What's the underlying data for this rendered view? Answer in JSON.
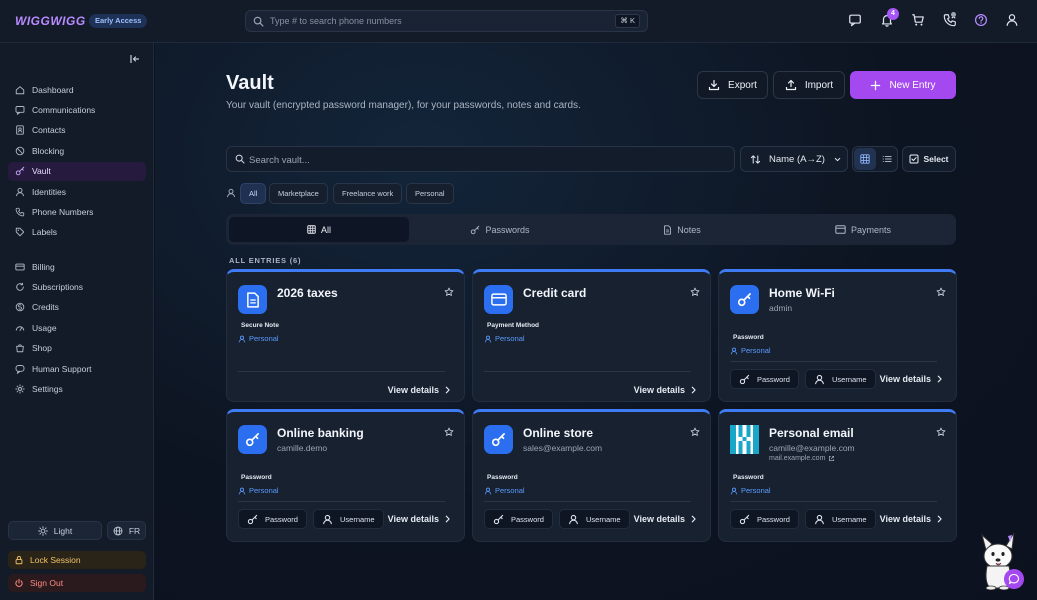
{
  "app": {
    "logo": "WIGGWIGG",
    "badge": "Early Access"
  },
  "topbar": {
    "search_placeholder": "Type # to search phone numbers",
    "shortcut": "⌘ K",
    "notification_count": "4"
  },
  "sidebar": {
    "groups": [
      [
        {
          "label": "Dashboard",
          "icon": "home-icon"
        },
        {
          "label": "Communications",
          "icon": "chat-icon"
        },
        {
          "label": "Contacts",
          "icon": "contacts-icon"
        },
        {
          "label": "Blocking",
          "icon": "block-icon"
        },
        {
          "label": "Vault",
          "icon": "key-icon",
          "active": true
        },
        {
          "label": "Identities",
          "icon": "person-icon"
        },
        {
          "label": "Phone Numbers",
          "icon": "phone-icon"
        },
        {
          "label": "Labels",
          "icon": "tag-icon"
        }
      ],
      [
        {
          "label": "Billing",
          "icon": "billing-icon"
        },
        {
          "label": "Subscriptions",
          "icon": "refresh-icon"
        },
        {
          "label": "Credits",
          "icon": "coin-icon"
        },
        {
          "label": "Usage",
          "icon": "gauge-icon"
        },
        {
          "label": "Shop",
          "icon": "shop-icon"
        },
        {
          "label": "Human Support",
          "icon": "support-icon"
        },
        {
          "label": "Settings",
          "icon": "gear-icon"
        }
      ]
    ],
    "theme_label": "Light",
    "language_label": "FR",
    "lock_label": "Lock Session",
    "signout_label": "Sign Out"
  },
  "page": {
    "title": "Vault",
    "subtitle": "Your vault (encrypted password manager), for your passwords, notes and cards.",
    "export_label": "Export",
    "import_label": "Import",
    "new_entry_label": "New Entry",
    "search_placeholder": "Search vault...",
    "sort_label": "Name (A→Z)",
    "select_label": "Select",
    "identity_filters": [
      "All",
      "Marketplace",
      "Freelance work",
      "Personal"
    ],
    "tabs": [
      "All",
      "Passwords",
      "Notes",
      "Payments"
    ],
    "entries_label": "ALL ENTRIES (6)"
  },
  "entries": [
    {
      "title": "2026 taxes",
      "subtitle": "",
      "type": "Secure Note",
      "folder": "Personal",
      "icon": "document-icon",
      "view": "View details"
    },
    {
      "title": "Credit card",
      "subtitle": "",
      "type": "Payment Method",
      "folder": "Personal",
      "icon": "credit-card-icon",
      "view": "View details"
    },
    {
      "title": "Home Wi-Fi",
      "subtitle": "admin",
      "type": "Password",
      "folder": "Personal",
      "icon": "key-icon",
      "view": "View details",
      "pill_password": "Password",
      "pill_username": "Username"
    },
    {
      "title": "Online banking",
      "subtitle": "camille.demo",
      "type": "Password",
      "folder": "Personal",
      "icon": "key-icon",
      "view": "View details",
      "pill_password": "Password",
      "pill_username": "Username"
    },
    {
      "title": "Online store",
      "subtitle": "sales@example.com",
      "type": "Password",
      "folder": "Personal",
      "icon": "key-icon",
      "view": "View details",
      "pill_password": "Password",
      "pill_username": "Username"
    },
    {
      "title": "Personal email",
      "subtitle": "camille@example.com",
      "link": "mail.example.com",
      "type": "Password",
      "folder": "Personal",
      "icon": "site-favicon-icon",
      "view": "View details",
      "pill_password": "Password",
      "pill_username": "Username"
    }
  ],
  "colors": {
    "accent": "#a448ef",
    "card_accent": "#3f7bf2",
    "folder": "#5b9bff"
  }
}
